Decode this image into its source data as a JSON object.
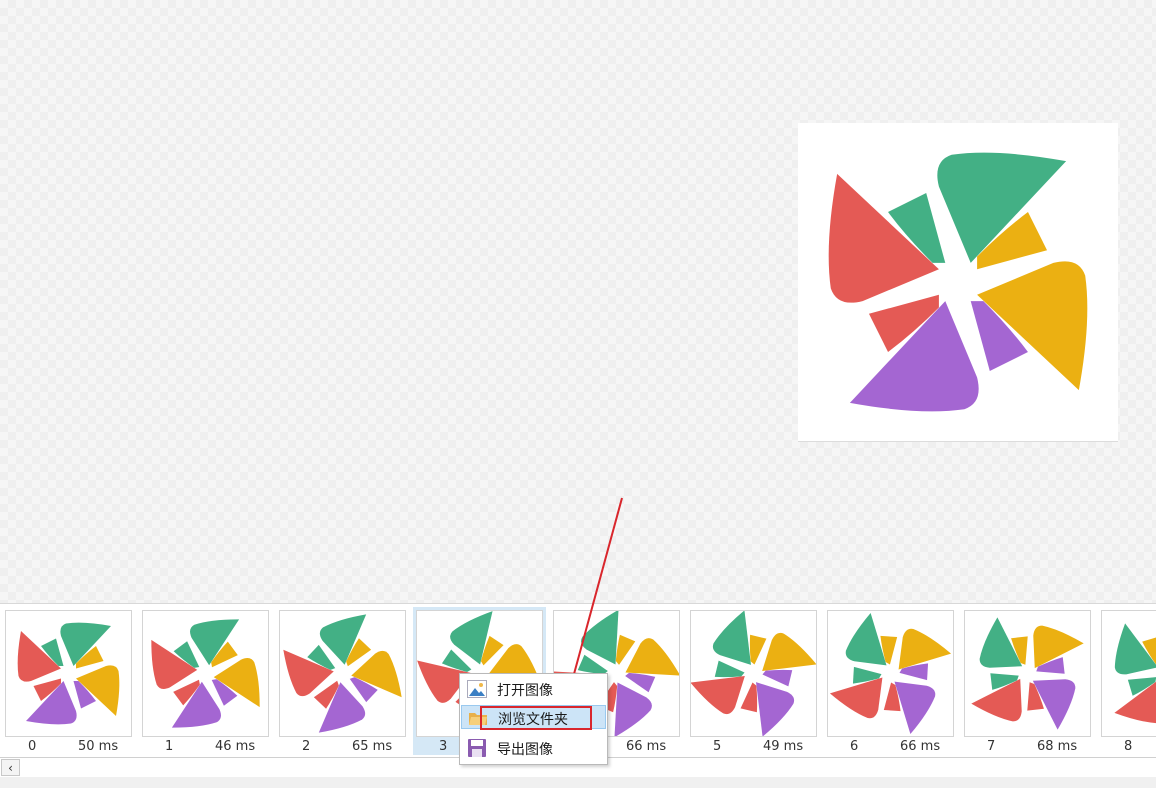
{
  "frames": [
    {
      "index": "0",
      "duration": "50 ms",
      "rotation": 0
    },
    {
      "index": "1",
      "duration": "46 ms",
      "rotation": -10
    },
    {
      "index": "2",
      "duration": "65 ms",
      "rotation": -20
    },
    {
      "index": "3",
      "duration": "",
      "rotation": -30
    },
    {
      "index": "",
      "duration": "66 ms",
      "rotation": -40
    },
    {
      "index": "5",
      "duration": "49 ms",
      "rotation": -50
    },
    {
      "index": "6",
      "duration": "66 ms",
      "rotation": -60
    },
    {
      "index": "7",
      "duration": "68 ms",
      "rotation": -70
    },
    {
      "index": "8",
      "duration": "",
      "rotation": -80
    }
  ],
  "selected_frame": "3",
  "context_menu": {
    "items": [
      {
        "label": "打开图像",
        "icon": "image-icon"
      },
      {
        "label": "浏览文件夹",
        "icon": "folder-icon"
      },
      {
        "label": "导出图像",
        "icon": "save-icon"
      }
    ],
    "hovered_item": "浏览文件夹"
  },
  "scrollbar": {
    "left_arrow": "‹"
  },
  "colors": {
    "pinwheel_red": "#e45a55",
    "pinwheel_green": "#43b085",
    "pinwheel_yellow": "#ebb012",
    "pinwheel_purple": "#a466d2",
    "annotation_red": "#d9262c",
    "selection_blue": "#d5e8f6"
  }
}
